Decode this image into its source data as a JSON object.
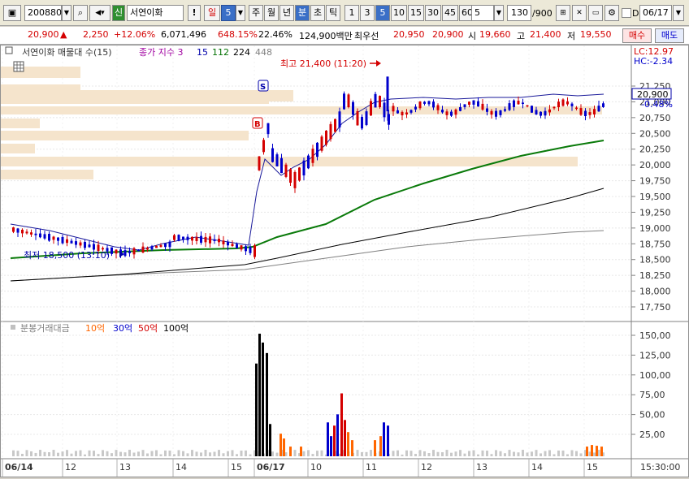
{
  "toolbar": {
    "stock_code": "200880",
    "credit_badge": "신",
    "stock_name": "서연이화",
    "alert_label": "!",
    "period_day": "일",
    "period_value": "5",
    "period_week": "주",
    "period_month": "월",
    "period_year": "년",
    "period_minute": "분",
    "period_second": "초",
    "period_tick": "틱",
    "intervals": [
      "1",
      "3",
      "5",
      "10",
      "15",
      "30",
      "45",
      "60"
    ],
    "selected_interval": "5",
    "interval_dropdown": "5",
    "count_value": "130",
    "count_total": "/900",
    "date_value": "06/17",
    "date_checkbox": "D"
  },
  "quote": {
    "price": "20,900",
    "direction": "▲",
    "change": "2,250",
    "change_pct": "+12.06%",
    "volume": "6,071,496",
    "volume_ratio": "648.15%",
    "turnover": "22.46%",
    "amount": "124,900백만",
    "best_ask_label": "최우선",
    "best_ask": "20,950",
    "best_bid": "20,900",
    "open_label": "시",
    "open": "19,660",
    "high_label": "고",
    "high": "21,400",
    "low_label": "저",
    "low": "19,550",
    "buy_label": "매수",
    "sell_label": "매도"
  },
  "price_pane": {
    "legend_name": "서연이화 매물대 수(15)",
    "legend_ma": "종가 지수 3",
    "ma_periods": [
      "15",
      "112",
      "224",
      "448"
    ],
    "ma_colors": [
      "#0000aa",
      "#007000",
      "#000000",
      "#808080"
    ],
    "high_annotation": "최고 21,400 (11:20)",
    "low_annotation": "최저 18,500 (13:10)",
    "lc_label": "LC:12.97",
    "hc_label": "HC:-2.34",
    "current_price_tag": "20,900",
    "current_pct_tag": "-0.48%",
    "y_ticks": [
      "21,250",
      "21,000",
      "20,750",
      "20,500",
      "20,250",
      "20,000",
      "19,750",
      "19,500",
      "19,250",
      "19,000",
      "18,750",
      "18,500",
      "18,250",
      "18,000",
      "17,750"
    ],
    "marker_s": "S",
    "marker_b": "B"
  },
  "volume_pane": {
    "legend_name": "분봉거래대금",
    "legend_10": "10억",
    "legend_30": "30억",
    "legend_50": "50억",
    "legend_100": "100억",
    "y_ticks": [
      "150,00",
      "125,00",
      "100,00",
      "75,00",
      "50,00",
      "25,00"
    ]
  },
  "x_axis": {
    "labels": [
      "06/14",
      "12",
      "13",
      "14",
      "15",
      "06/17",
      "10",
      "11",
      "12",
      "13",
      "14",
      "15"
    ],
    "time": "15:30:00"
  },
  "colors": {
    "up": "#d40000",
    "down": "#0000cc",
    "ma15": "#1a1a9a",
    "ma112": "#0a7a0a",
    "ma224": "#000000",
    "ma448": "#808080",
    "volume_profile": "#f5e4cc"
  }
}
